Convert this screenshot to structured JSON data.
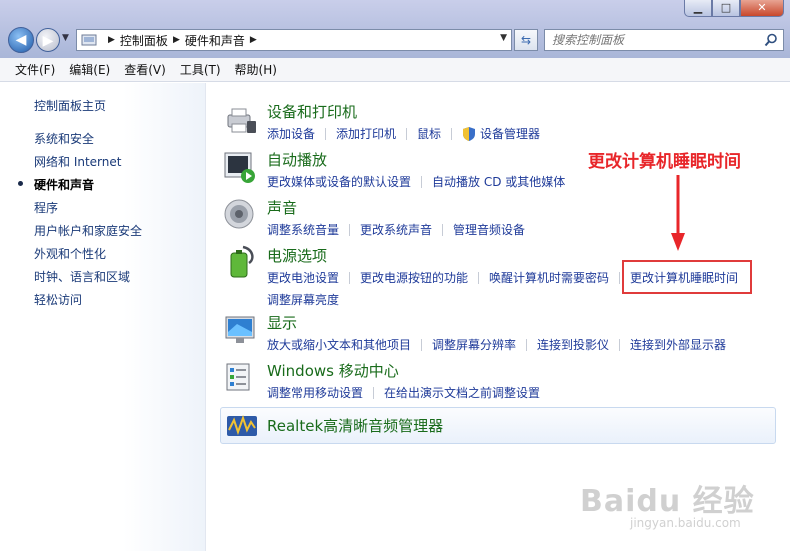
{
  "window": {
    "controls": {
      "minimize": "▁",
      "maximize": "□",
      "close": "✕"
    }
  },
  "address": {
    "crumbs": [
      "控制面板",
      "硬件和声音"
    ]
  },
  "search": {
    "placeholder": "搜索控制面板"
  },
  "menu": [
    "文件(F)",
    "编辑(E)",
    "查看(V)",
    "工具(T)",
    "帮助(H)"
  ],
  "sidebar": {
    "home": "控制面板主页",
    "items": [
      {
        "label": "系统和安全"
      },
      {
        "label": "网络和 Internet"
      },
      {
        "label": "硬件和声音",
        "active": true
      },
      {
        "label": "程序"
      },
      {
        "label": "用户帐户和家庭安全"
      },
      {
        "label": "外观和个性化"
      },
      {
        "label": "时钟、语言和区域"
      },
      {
        "label": "轻松访问"
      }
    ]
  },
  "categories": {
    "devices": {
      "title": "设备和打印机",
      "links": [
        "添加设备",
        "添加打印机",
        "鼠标",
        "设备管理器"
      ]
    },
    "autoplay": {
      "title": "自动播放",
      "links": [
        "更改媒体或设备的默认设置",
        "自动播放 CD 或其他媒体"
      ]
    },
    "sound": {
      "title": "声音",
      "links": [
        "调整系统音量",
        "更改系统声音",
        "管理音频设备"
      ]
    },
    "power": {
      "title": "电源选项",
      "links": [
        "更改电池设置",
        "更改电源按钮的功能",
        "唤醒计算机时需要密码",
        "更改计算机睡眠时间",
        "调整屏幕亮度"
      ]
    },
    "display": {
      "title": "显示",
      "links": [
        "放大或缩小文本和其他项目",
        "调整屏幕分辨率",
        "连接到投影仪",
        "连接到外部显示器"
      ]
    },
    "mobility": {
      "title": "Windows 移动中心",
      "links": [
        "调整常用移动设置",
        "在给出演示文档之前调整设置"
      ]
    },
    "realtek": {
      "title": "Realtek高清晰音频管理器"
    }
  },
  "annotation": {
    "text": "更改计算机睡眠时间",
    "color": "#e8262a"
  },
  "watermark": {
    "logo": "Baidu 经验",
    "url": "jingyan.baidu.com"
  },
  "colors": {
    "link": "#1e3a99",
    "title": "#196b1b",
    "nav": "#1a3a78"
  }
}
